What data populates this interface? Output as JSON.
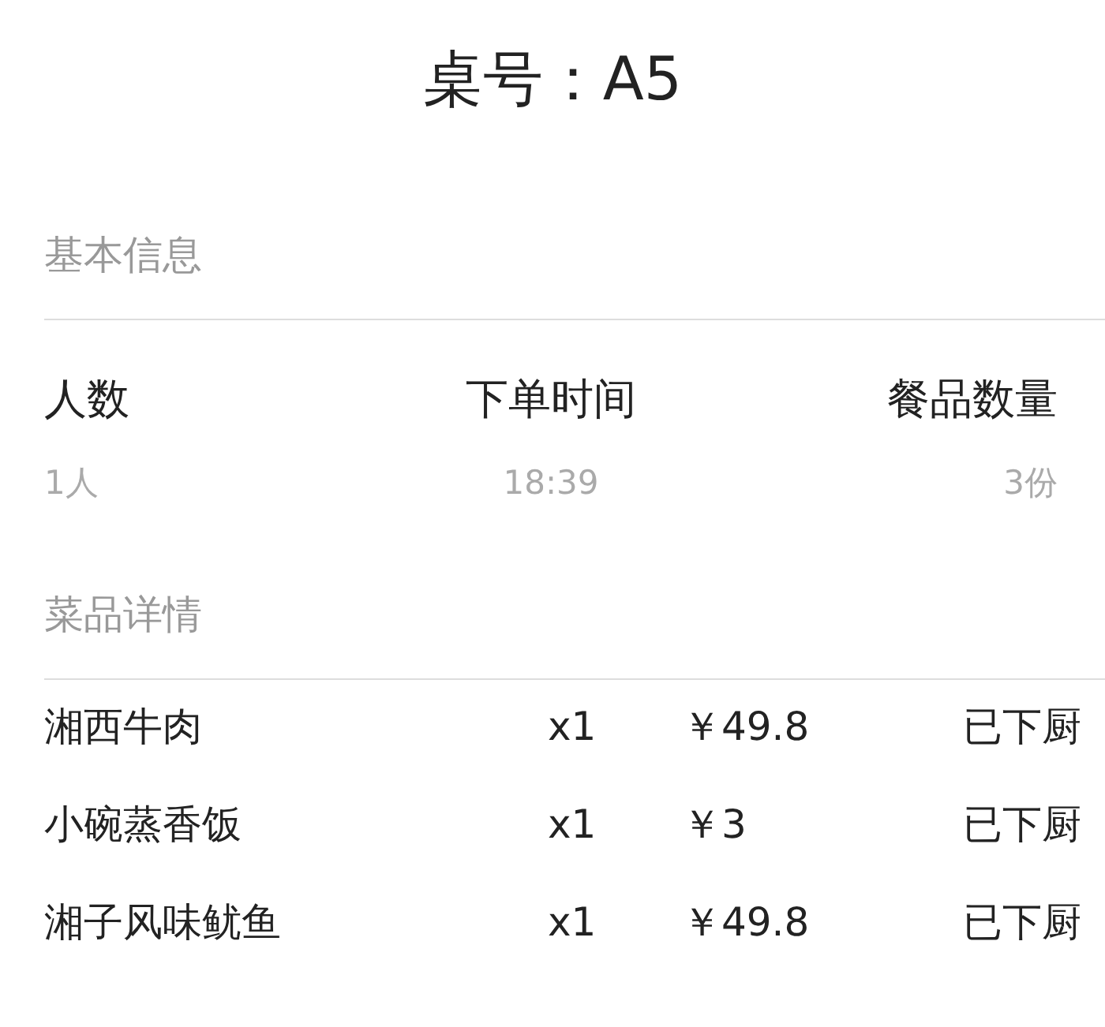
{
  "title": "桌号：A5",
  "basic_info": {
    "heading": "基本信息",
    "fields": [
      {
        "label": "人数",
        "value": "1人"
      },
      {
        "label": "下单时间",
        "value": "18:39"
      },
      {
        "label": "餐品数量",
        "value": "3份"
      }
    ]
  },
  "dishes": {
    "heading": "菜品详情",
    "rows": [
      {
        "name": "湘西牛肉",
        "quantity": "x1",
        "price": "￥49.8",
        "status": "已下厨"
      },
      {
        "name": "小碗蒸香饭",
        "quantity": "x1",
        "price": "￥3",
        "status": "已下厨"
      },
      {
        "name": "湘子风味鱿鱼",
        "quantity": "x1",
        "price": "￥49.8",
        "status": "已下厨"
      }
    ]
  }
}
